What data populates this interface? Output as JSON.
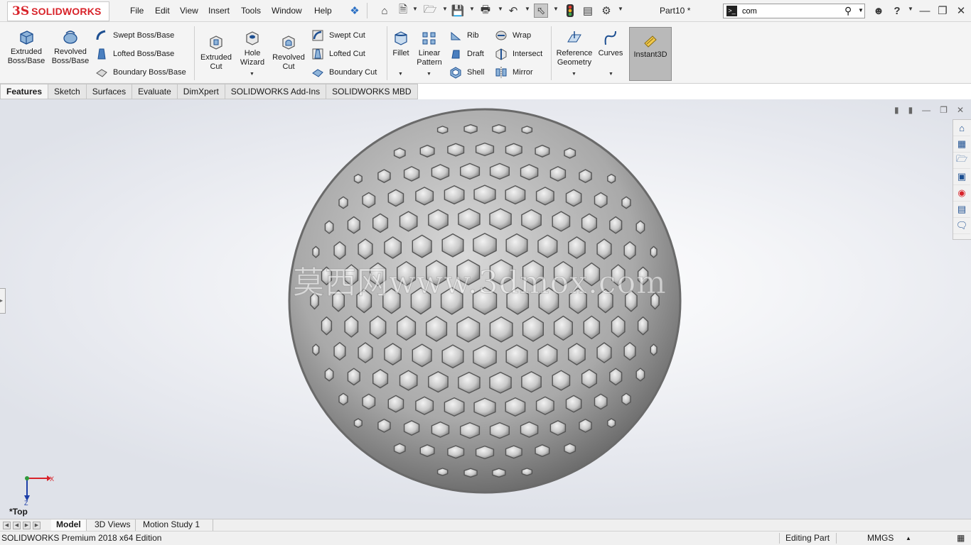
{
  "app": {
    "logo_ds": "3S",
    "logo_text": "SOLIDWORKS"
  },
  "menu": [
    "File",
    "Edit",
    "View",
    "Insert",
    "Tools",
    "Window",
    "Help"
  ],
  "document_title": "Part10 *",
  "search": {
    "value": "com"
  },
  "features": {
    "extruded_boss": "Extruded Boss/Base",
    "revolved_boss": "Revolved Boss/Base",
    "swept_boss": "Swept Boss/Base",
    "lofted_boss": "Lofted Boss/Base",
    "boundary_boss": "Boundary Boss/Base",
    "extruded_cut": "Extruded Cut",
    "hole_wizard": "Hole Wizard",
    "revolved_cut": "Revolved Cut",
    "swept_cut": "Swept Cut",
    "lofted_cut": "Lofted Cut",
    "boundary_cut": "Boundary Cut",
    "fillet": "Fillet",
    "linear_pattern": "Linear Pattern",
    "rib": "Rib",
    "draft": "Draft",
    "shell": "Shell",
    "wrap": "Wrap",
    "intersect": "Intersect",
    "mirror": "Mirror",
    "reference_geometry": "Reference Geometry",
    "curves": "Curves",
    "instant3d": "Instant3D"
  },
  "tabs": [
    "Features",
    "Sketch",
    "Surfaces",
    "Evaluate",
    "DimXpert",
    "SOLIDWORKS Add-Ins",
    "SOLIDWORKS MBD"
  ],
  "viewport": {
    "watermark": "莫西网www.3dmox.com",
    "view_name": "*Top",
    "axis_x": "X",
    "axis_z": "Z"
  },
  "bottom_tabs": [
    "Model",
    "3D Views",
    "Motion Study 1"
  ],
  "status": {
    "edition": "SOLIDWORKS Premium 2018 x64 Edition",
    "mode": "Editing Part",
    "units": "MMGS"
  },
  "colors": {
    "brand_red": "#d8232a",
    "icon_blue": "#1d4f91",
    "icon_gray": "#5a6470"
  }
}
